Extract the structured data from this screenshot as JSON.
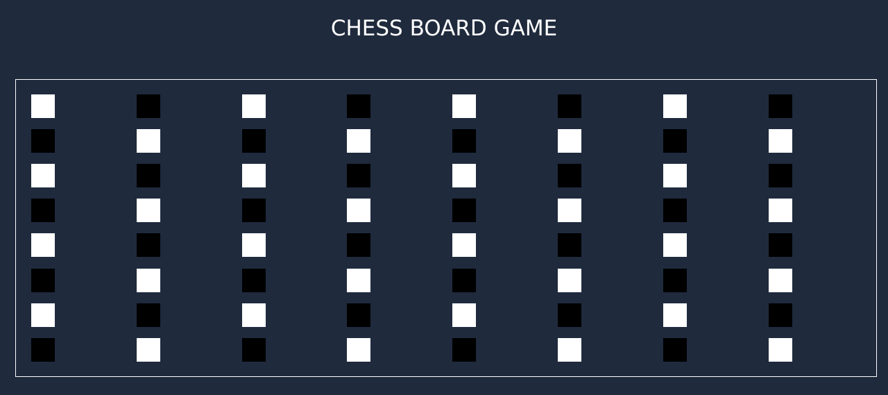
{
  "title": "CHESS BOARD GAME",
  "board": {
    "rows": 8,
    "columns": 8,
    "light_color": "#ffffff",
    "dark_color": "#000000",
    "frame_color": "#ffffff",
    "background_color": "#1f2a3d",
    "top_left_square": "light"
  }
}
